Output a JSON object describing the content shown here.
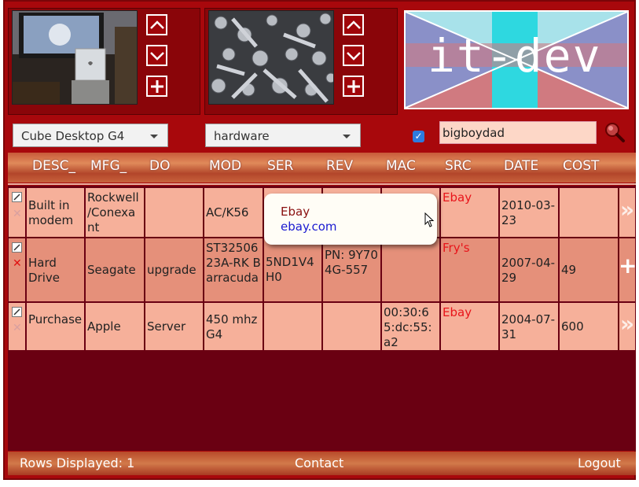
{
  "panels": [
    {
      "image": "cube-desktop-photo"
    },
    {
      "image": "hardware-bolts-photo"
    }
  ],
  "nav_icons": [
    "chevron-up-icon",
    "chevron-down-icon",
    "plus-icon"
  ],
  "logo": {
    "text": "it-dev"
  },
  "filters": {
    "item_select": "Cube Desktop G4",
    "category_select": "hardware",
    "checkbox_checked": true,
    "search_value": "bigboydad"
  },
  "columns": [
    "DESC_",
    "MFG_",
    "DO",
    "MOD",
    "SER",
    "REV",
    "MAC",
    "SRC",
    "DATE",
    "COST"
  ],
  "rows": [
    {
      "desc": "Built in modem",
      "mfg": "Rockwell /Conexant",
      "do": "",
      "mod": "AC/K56",
      "ser": "",
      "rev": "",
      "mac": "",
      "src": "Ebay",
      "date": "2010-03-23",
      "cost": "",
      "action": "»"
    },
    {
      "desc": "Hard Drive",
      "mfg": "Seagate",
      "do": "upgrade",
      "mod": "ST3250623A-RK Barracuda",
      "ser": "5ND1V4H0",
      "rev": "PN: 9Y704G-557",
      "mac": "",
      "src": "Fry's",
      "date": "2007-04-29",
      "cost": "49",
      "action": "+"
    },
    {
      "desc": "Purchase",
      "mfg": "Apple",
      "do": "Server",
      "mod": "450 mhz G4",
      "ser": "",
      "rev": "",
      "mac": "00:30:65:dc:55:a2",
      "src": "Ebay",
      "date": "2004-07-31",
      "cost": "600",
      "action": "»"
    }
  ],
  "tooltip": {
    "line1": "Ebay",
    "line2": "ebay.com"
  },
  "footer": {
    "rows_displayed": "Rows Displayed: 1",
    "contact": "Contact",
    "logout": "Logout"
  },
  "colors": {
    "frame": "#a8080c",
    "table_bg": "#6a0012",
    "row_light": "#f6b09a",
    "row_dark": "#e5907a",
    "src_text": "#e8141a"
  }
}
